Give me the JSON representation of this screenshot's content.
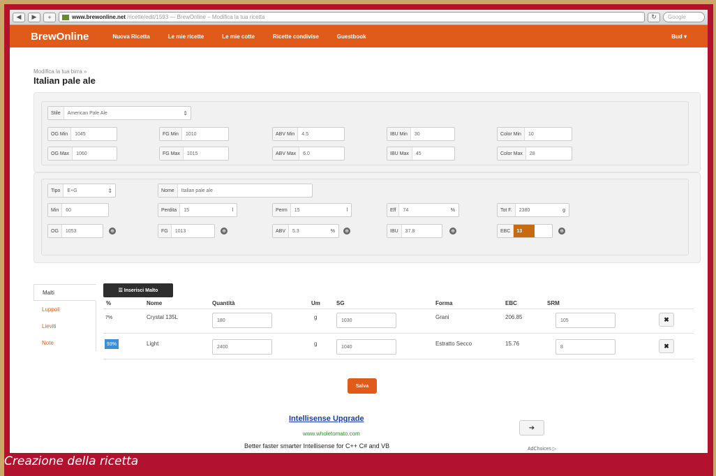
{
  "browser": {
    "url_host": "www.brewonline.net",
    "url_rest": "/ricette/edit/1593 — BrewOnline – Modifica la tua ricetta",
    "search_placeholder": "Google"
  },
  "nav": {
    "brand": "BrewOnline",
    "items": [
      "Nuova Ricetta",
      "Le mie ricette",
      "Le mie cotte",
      "Ricette condivise",
      "Guestbook"
    ],
    "user": "Bud ▾"
  },
  "page": {
    "breadcrumb": "Modifica la tua birra »",
    "title": "Italian pale ale"
  },
  "style": {
    "label": "Stile",
    "value": "American Pale Ale",
    "row_min": [
      {
        "label": "OG Min",
        "value": "1045"
      },
      {
        "label": "FG Min",
        "value": "1010"
      },
      {
        "label": "ABV Min",
        "value": "4.5"
      },
      {
        "label": "IBU Min",
        "value": "30"
      },
      {
        "label": "Color Min",
        "value": "10"
      }
    ],
    "row_max": [
      {
        "label": "OG Max",
        "value": "1060"
      },
      {
        "label": "FG Max",
        "value": "1015"
      },
      {
        "label": "ABV Max",
        "value": "6.0"
      },
      {
        "label": "IBU Max",
        "value": "45"
      },
      {
        "label": "Color Max",
        "value": "28"
      }
    ]
  },
  "recipe": {
    "tipo_label": "Tipo",
    "tipo_value": "E+G",
    "nome_label": "Nome",
    "nome_value": "Italian pale ale",
    "min_label": "Min",
    "min_value": "60",
    "perdita_label": "Perdita",
    "perdita_value": "15",
    "perm_label": "Perm",
    "perm_value": "15",
    "eff_label": "Eff",
    "eff_value": "74",
    "eff_unit": "%",
    "tot_label": "Tot F.",
    "tot_value": "2380",
    "tot_unit": "g",
    "og_label": "OG",
    "og_value": "1053",
    "fg_label": "FG",
    "fg_value": "1013",
    "abv_label": "ABV",
    "abv_value": "5.3",
    "abv_unit": "%",
    "ibu_label": "IBU",
    "ibu_value": "37.8",
    "ebc_label": "EBC",
    "ebc_value": "13"
  },
  "tabs": [
    "Malti",
    "Luppoli",
    "Lieviti",
    "Note"
  ],
  "table": {
    "insert_button": "☰ Inserisci Malto",
    "headers": [
      "%",
      "Nome",
      "Quantità",
      "Um",
      "SG",
      "Forma",
      "EBC",
      "SRM"
    ],
    "rows": [
      {
        "pct": "7%",
        "nome": "Crystal 135L",
        "qty": "180",
        "um": "g",
        "sg": "1030",
        "forma": "Grani",
        "ebc": "206.85",
        "srm": "105"
      },
      {
        "pct": "93%",
        "nome": "Light",
        "qty": "2400",
        "um": "g",
        "sg": "1040",
        "forma": "Estratto Secco",
        "ebc": "15.76",
        "srm": "8"
      }
    ],
    "delete_icon": "✖"
  },
  "save_label": "Salva",
  "ad": {
    "title": "Intellisense Upgrade",
    "url": "www.wholetomato.com",
    "text": "Better faster smarter Intellisense for C++ C# and VB",
    "choices": "AdChoices ▷"
  },
  "caption": "Creazione della ricetta"
}
